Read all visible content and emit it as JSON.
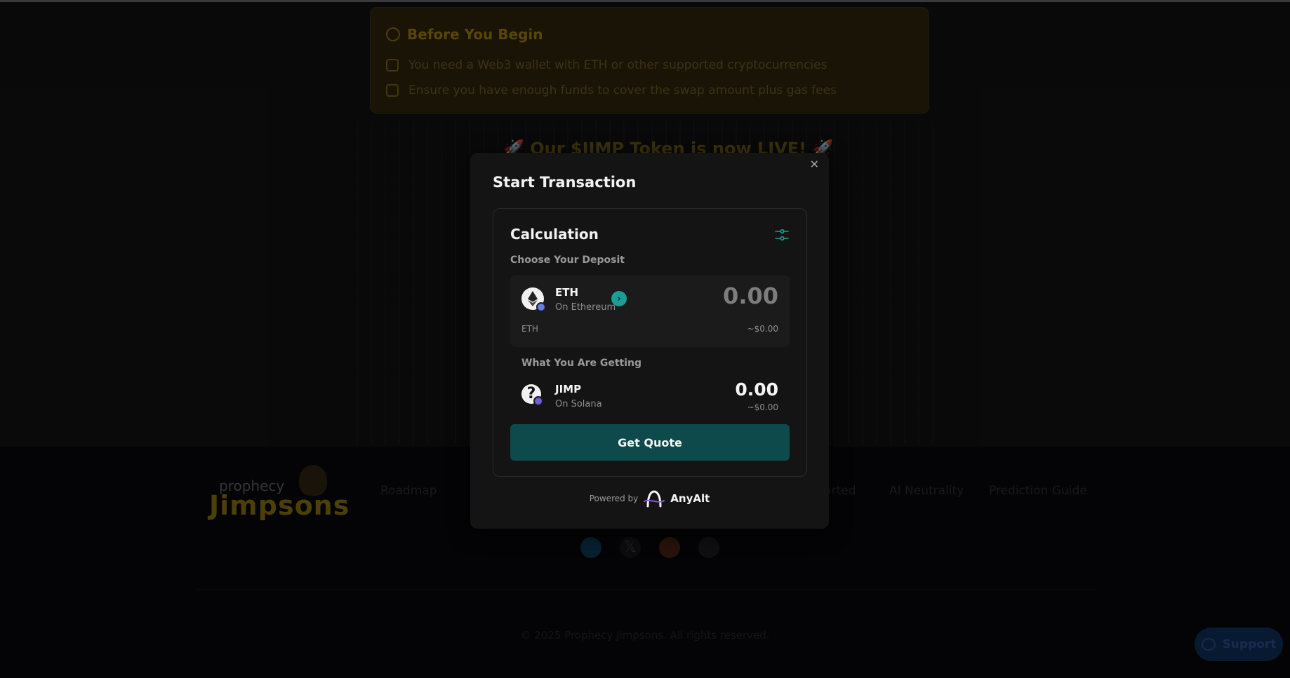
{
  "background": {
    "before_title": "Before You Begin",
    "before_items": [
      "You need a Web3 wallet with ETH or other supported cryptocurrencies",
      "Ensure you have enough funds to cover the swap amount plus gas fees"
    ],
    "banner": "🚀 Our $JIMP Token is now LIVE! 🚀",
    "footer": {
      "logo_top": "prophecy",
      "logo_main": "Jimpsons",
      "links": [
        "Roadmap",
        "Get Started",
        "AI Neutrality",
        "Prediction Guide"
      ],
      "copyright": "© 2025 Prophecy Jimpsons. All rights reserved."
    },
    "support_label": "Support"
  },
  "modal": {
    "title": "Start Transaction",
    "close_label": "×",
    "calculation_title": "Calculation",
    "choose_label": "Choose Your Deposit",
    "deposit": {
      "symbol": "ETH",
      "chain": "On Ethereum",
      "amount_placeholder": "0.00",
      "unit": "ETH",
      "usd_value": "~$0.00",
      "select_glyph": "›"
    },
    "getting_label": "What You Are Getting",
    "receive": {
      "symbol": "JIMP",
      "chain": "On Solana",
      "amount": "0.00",
      "usd_value": "~$0.00",
      "icon_glyph": "?"
    },
    "quote_button": "Get Quote",
    "powered_by": "Powered by",
    "provider": "AnyAlt"
  },
  "colors": {
    "accent_teal": "#1a9e95",
    "button_teal": "#0e4a4c",
    "ethereum_badge": "#627eea",
    "solana_badge": "#6b5fd6"
  }
}
